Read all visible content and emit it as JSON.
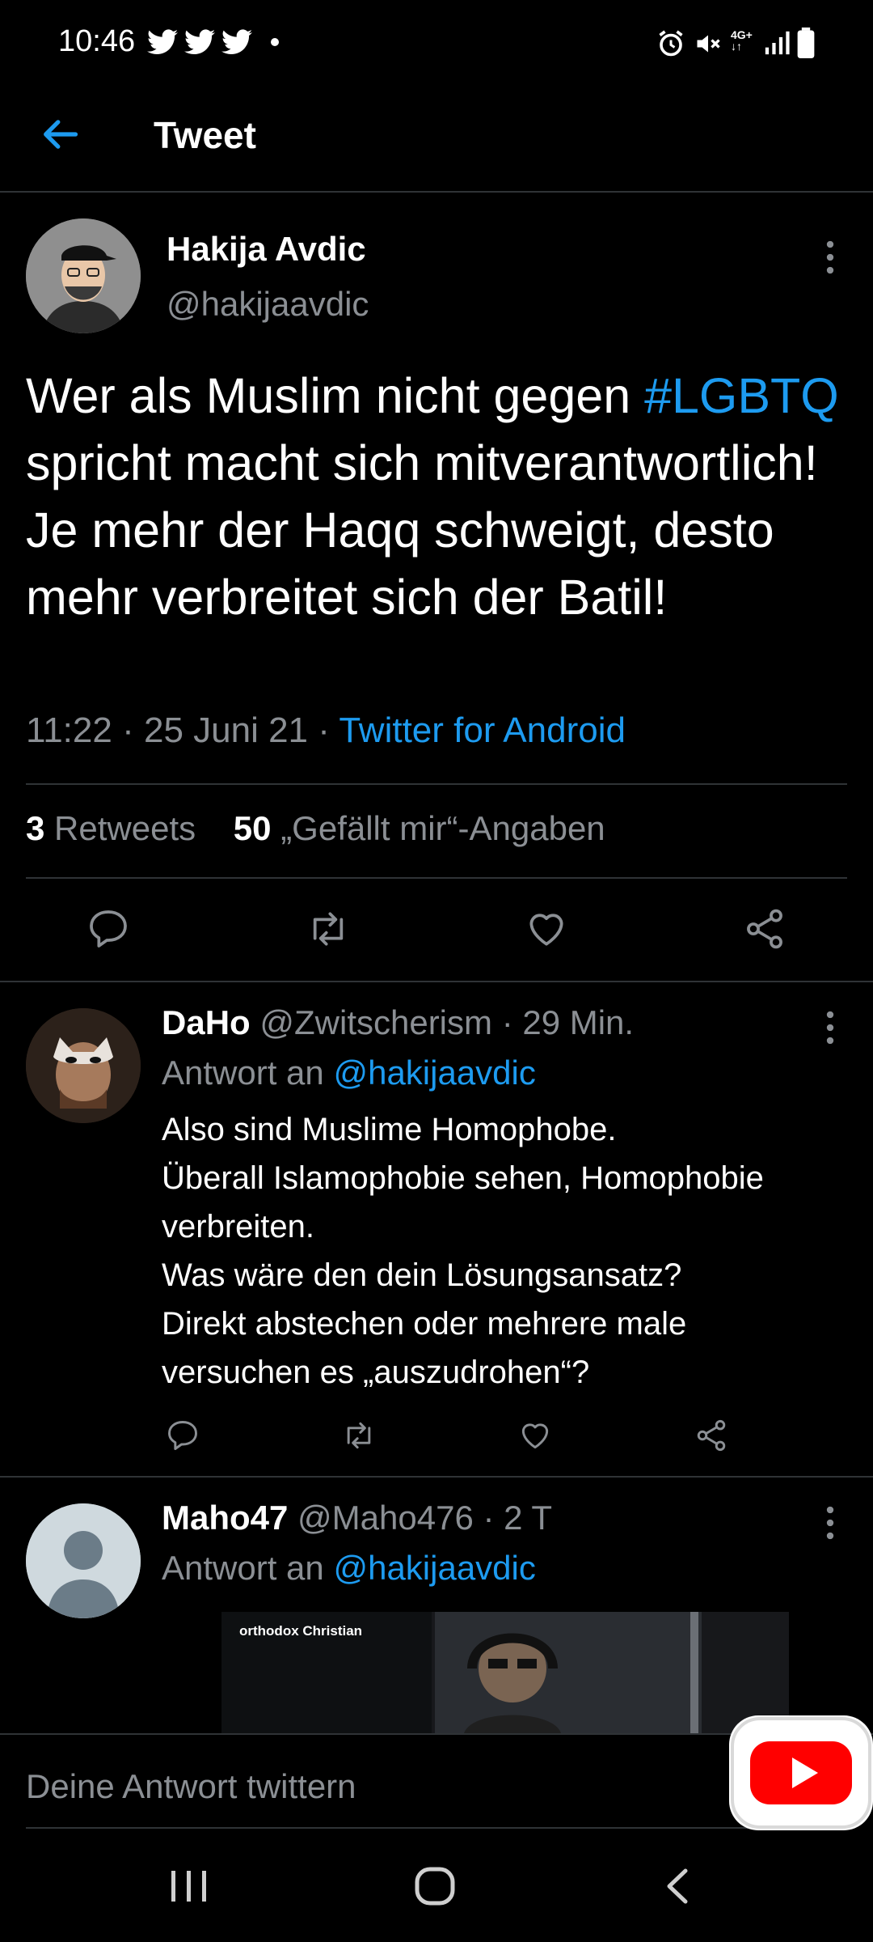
{
  "status_bar": {
    "time": "10:46",
    "icons": [
      "twitter-bird-icon",
      "twitter-bird-icon",
      "twitter-bird-icon",
      "dot-icon",
      "alarm-icon",
      "mute-icon",
      "4g-icon",
      "signal-icon",
      "battery-icon"
    ],
    "network_label": "4G+"
  },
  "top_bar": {
    "title": "Tweet"
  },
  "tweet": {
    "author_name": "Hakija Avdic",
    "author_handle": "@hakijaavdic",
    "text_before": "Wer als Muslim nicht gegen ",
    "hashtag": "#LGBTQ",
    "text_after": " spricht macht sich mitverantwortlich! Je mehr der Haqq schweigt, desto mehr verbreitet sich der Batil!",
    "time": "11:22",
    "date": "25 Juni 21",
    "separator": "·",
    "source": "Twitter for Android",
    "retweet_count": "3",
    "retweet_label": "Retweets",
    "like_count": "50",
    "like_label": "„Gefällt mir“-Angaben"
  },
  "replies": [
    {
      "name": "DaHo",
      "handle": "@Zwitscherism",
      "time": "· 29 Min.",
      "reply_to_prefix": "Antwort an ",
      "reply_to_handle": "@hakijaavdic",
      "lines": [
        "Also sind Muslime Homophobe.",
        "Überall Islamophobie sehen, Homophobie",
        "verbreiten.",
        "Was wäre den dein Lösungsansatz?",
        "Direkt abstechen oder mehrere male",
        "versuchen es „auszudrohen“?"
      ]
    },
    {
      "name": "Maho47",
      "handle": "@Maho476",
      "time": "· 2 T",
      "reply_to_prefix": "Antwort an ",
      "reply_to_handle": "@hakijaavdic",
      "media_caption": "orthodox Christian"
    }
  ],
  "compose": {
    "placeholder": "Deine Antwort twittern"
  },
  "colors": {
    "accent": "#1d9bf0",
    "background": "#000000",
    "secondary_text": "#8b8f94",
    "divider": "#2f3336",
    "youtube_red": "#ff0000"
  }
}
